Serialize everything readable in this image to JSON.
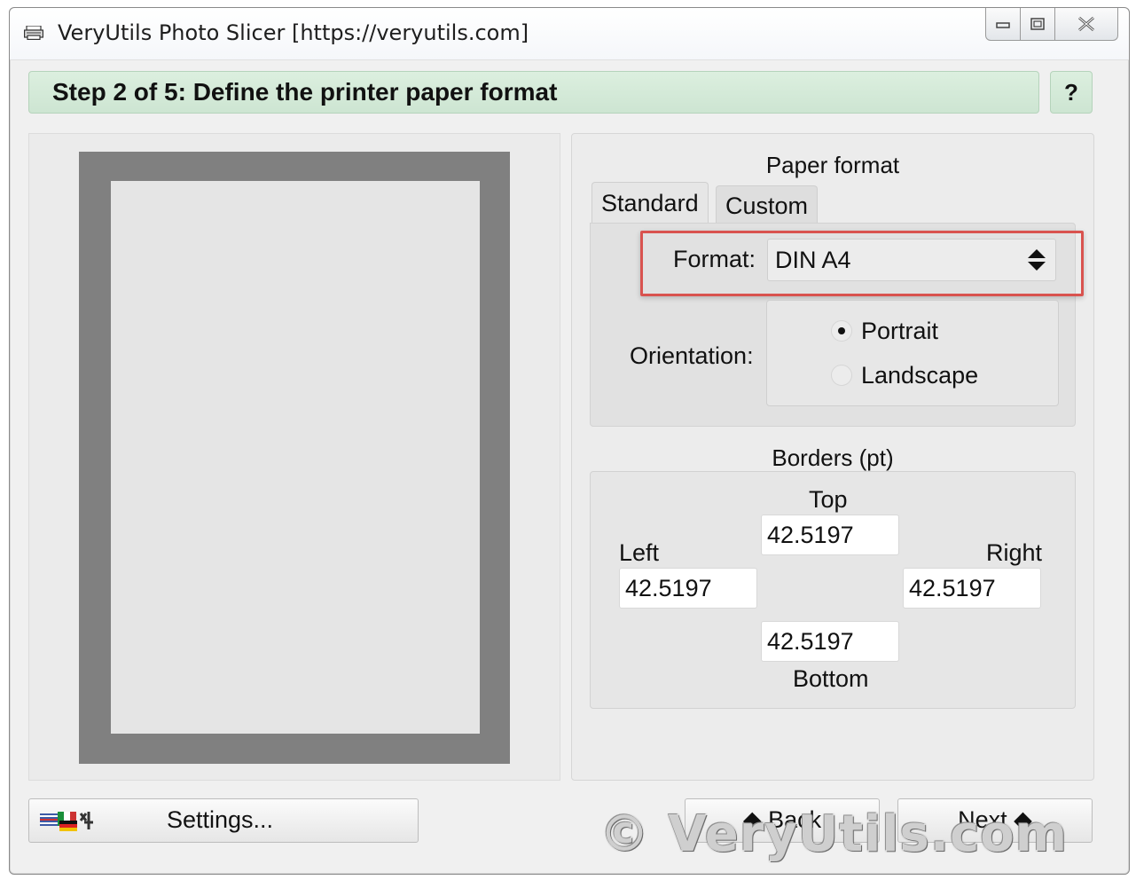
{
  "window": {
    "title": "VeryUtils Photo Slicer [https://veryutils.com]"
  },
  "step": {
    "title": "Step 2 of 5: Define the printer paper format",
    "help_label": "?"
  },
  "paper_format": {
    "section_title": "Paper format",
    "tabs": [
      {
        "label": "Standard",
        "active": true
      },
      {
        "label": "Custom",
        "active": false
      }
    ],
    "format_label": "Format:",
    "format_value": "DIN A4",
    "orientation_label": "Orientation:",
    "orientation_options": [
      {
        "label": "Portrait",
        "selected": true
      },
      {
        "label": "Landscape",
        "selected": false
      }
    ]
  },
  "borders": {
    "section_title": "Borders (pt)",
    "top_label": "Top",
    "top_value": "42.5197",
    "left_label": "Left",
    "left_value": "42.5197",
    "right_label": "Right",
    "right_value": "42.5197",
    "bottom_label": "Bottom",
    "bottom_value": "42.5197"
  },
  "footer": {
    "settings_label": "Settings...",
    "back_label": "◆ Back",
    "next_label": "Next ◆",
    "watermark": "© VeryUtils.com"
  },
  "colors": {
    "header_green": "#cde5d2",
    "highlight_red": "#d9534f",
    "paper_border": "#808080",
    "paper_inner": "#e5e5e5"
  },
  "icons": {
    "app": "printer-icon",
    "minimize": "minimize-icon",
    "maximize": "maximize-icon",
    "close": "close-icon",
    "format_select": "updown-arrows-icon",
    "settings": "language-flags-icon"
  }
}
